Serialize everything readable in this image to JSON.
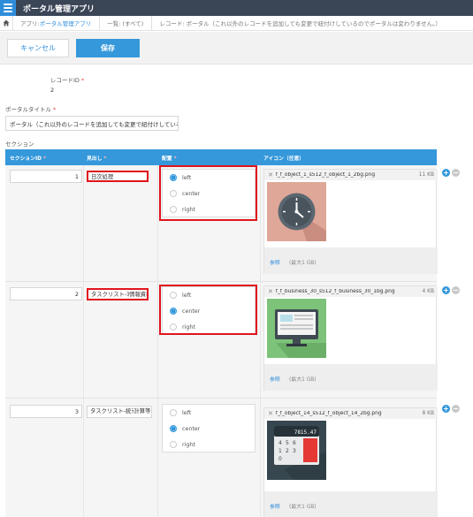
{
  "app": {
    "title": "ポータル管理アプリ"
  },
  "breadcrumb": {
    "app_prefix": "アプリ: ",
    "app_name": "ポータル管理アプリ",
    "list": "一覧: (すべて)",
    "record": "レコード: ポータル（これ以外のレコードを追加しても変更で紐付けしているのでポータルは変わりません。）"
  },
  "actions": {
    "cancel": "キャンセル",
    "save": "保存"
  },
  "record_id": {
    "label": "レコードID",
    "value": "2"
  },
  "portal_title": {
    "label": "ポータルタイトル",
    "value": "ポータル（これ以外のレコードを追加しても変更で紐付けしているの"
  },
  "section": {
    "label": "セクション",
    "columns": {
      "id": "セクションID",
      "heading": "見出し",
      "layout": "配置",
      "icon": "アイコン（任意）"
    },
    "rows": [
      {
        "id": "1",
        "heading": "日次処理",
        "layout": "left",
        "options": [
          "left",
          "center",
          "right"
        ],
        "file": {
          "name": "f_f_object_1_s512_f_object_1_2bg.png",
          "size": "11 KB",
          "thumb_bg": "#dfa798",
          "icon": "clock-icon"
        },
        "ref": "参照",
        "max": "(最大1 GB)"
      },
      {
        "id": "2",
        "heading": "タスクリスト-ﾖ情報資格",
        "layout": "center",
        "options": [
          "left",
          "center",
          "right"
        ],
        "file": {
          "name": "f_f_business_30_s512_f_business_30_1bg.png",
          "size": "4 KB",
          "thumb_bg": "#7dc37a",
          "icon": "monitor-icon"
        },
        "ref": "参照",
        "max": "(最大1 GB)"
      },
      {
        "id": "3",
        "heading": "タスクリスト-統ﾗ計算等",
        "layout": "center",
        "options": [
          "left",
          "center",
          "right"
        ],
        "file": {
          "name": "f_f_object_14_s512_f_object_14_2bg.png",
          "size": "8 KB",
          "thumb_bg": "#37474f",
          "icon": "calculator-icon",
          "display": "7815.47",
          "keys": [
            "4",
            "5",
            "6",
            "1",
            "2",
            "3",
            "0"
          ]
        },
        "ref": "参照",
        "max": "(最大1 GB)"
      }
    ]
  },
  "colors": {
    "accent": "#3498db",
    "highlight": "#e0141e",
    "topbar": "#3a4556"
  }
}
